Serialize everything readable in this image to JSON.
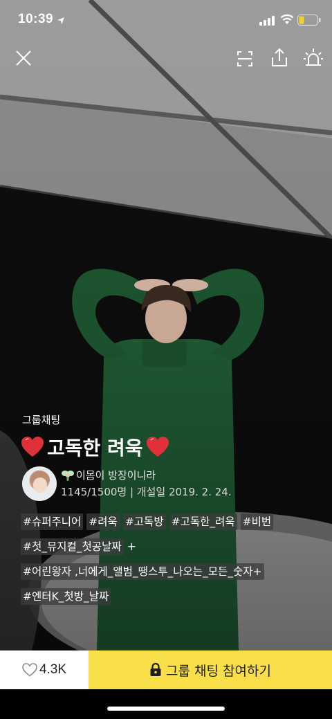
{
  "status_bar": {
    "time": "10:39"
  },
  "chat": {
    "type_label": "그룹채팅",
    "title": "고독한 려욱",
    "host_name": "이몸이 방장이니라",
    "meta": "1145/1500명 | 개설일 2019. 2. 24."
  },
  "tags": [
    [
      "#슈퍼주니어",
      "#려욱",
      "#고독방",
      "#고독한_려욱",
      "#비번"
    ],
    [
      "#첫_뮤지컬_첫공날짜"
    ],
    [
      "#어린왕자 ,너에게_앨범_땡스투_나오는_모든_숫자+"
    ],
    [
      "#엔터K_첫방_날짜"
    ]
  ],
  "tag_plus": "+",
  "bottom": {
    "like_count": "4.3K",
    "join_label": "그룹 채팅 참여하기"
  },
  "colors": {
    "join_button": "#f9e04b",
    "like_box": "#ffffff",
    "heart_red": "#e0303a"
  },
  "icons": {
    "close": "close-icon",
    "scan": "scan-icon",
    "share": "share-icon",
    "report": "siren-icon",
    "lock": "lock-icon",
    "heart": "heart-outline-icon"
  }
}
